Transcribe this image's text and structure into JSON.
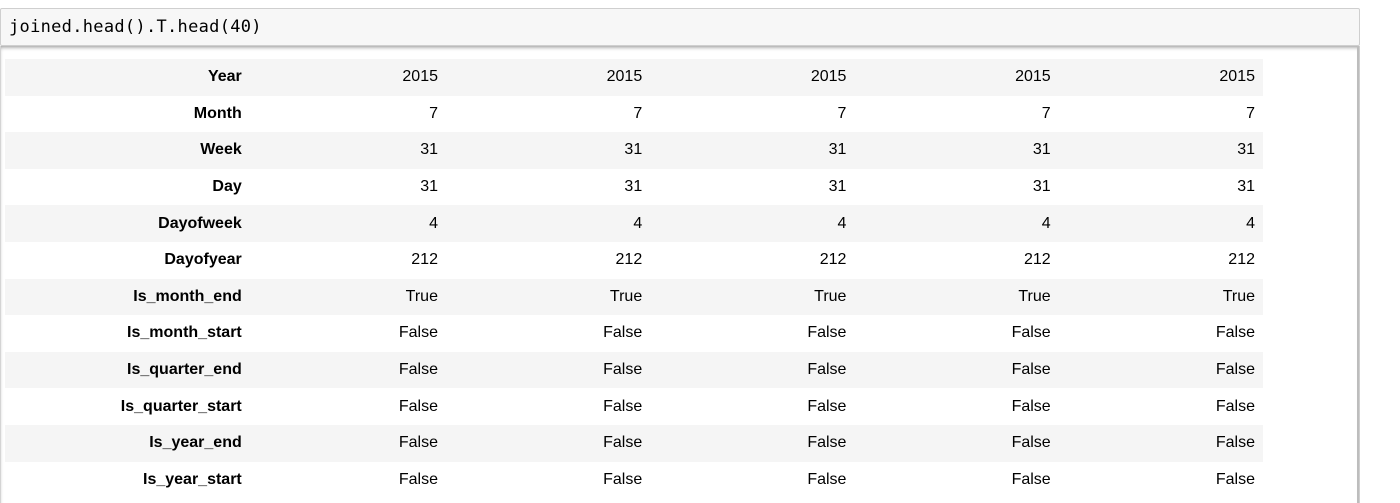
{
  "code_cell": {
    "source": "joined.head().T.head(40)"
  },
  "dataframe": {
    "rows": [
      {
        "label": "Year",
        "values": [
          "2015",
          "2015",
          "2015",
          "2015",
          "2015"
        ]
      },
      {
        "label": "Month",
        "values": [
          "7",
          "7",
          "7",
          "7",
          "7"
        ]
      },
      {
        "label": "Week",
        "values": [
          "31",
          "31",
          "31",
          "31",
          "31"
        ]
      },
      {
        "label": "Day",
        "values": [
          "31",
          "31",
          "31",
          "31",
          "31"
        ]
      },
      {
        "label": "Dayofweek",
        "values": [
          "4",
          "4",
          "4",
          "4",
          "4"
        ]
      },
      {
        "label": "Dayofyear",
        "values": [
          "212",
          "212",
          "212",
          "212",
          "212"
        ]
      },
      {
        "label": "Is_month_end",
        "values": [
          "True",
          "True",
          "True",
          "True",
          "True"
        ]
      },
      {
        "label": "Is_month_start",
        "values": [
          "False",
          "False",
          "False",
          "False",
          "False"
        ]
      },
      {
        "label": "Is_quarter_end",
        "values": [
          "False",
          "False",
          "False",
          "False",
          "False"
        ]
      },
      {
        "label": "Is_quarter_start",
        "values": [
          "False",
          "False",
          "False",
          "False",
          "False"
        ]
      },
      {
        "label": "Is_year_end",
        "values": [
          "False",
          "False",
          "False",
          "False",
          "False"
        ]
      },
      {
        "label": "Is_year_start",
        "values": [
          "False",
          "False",
          "False",
          "False",
          "False"
        ]
      }
    ]
  }
}
